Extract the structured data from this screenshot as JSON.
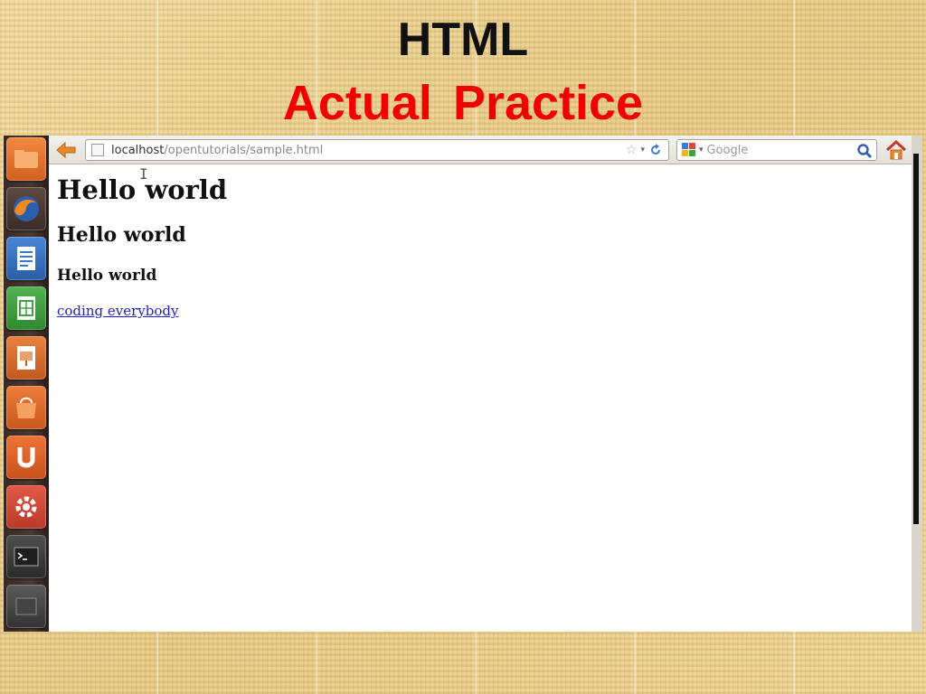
{
  "slide": {
    "title": "HTML",
    "subtitle": "Actual Practice"
  },
  "launcher": {
    "items": [
      {
        "name": "files-icon",
        "color": "#e7762e"
      },
      {
        "name": "firefox-icon",
        "color": "#2a5fae"
      },
      {
        "name": "writer-icon",
        "color": "#3a78c9"
      },
      {
        "name": "calc-icon",
        "color": "#3fa33f"
      },
      {
        "name": "impress-icon",
        "color": "#d86a2a"
      },
      {
        "name": "software-center-icon",
        "color": "#e06a2a"
      },
      {
        "name": "ubuntu-one-icon",
        "color": "#e0642a"
      },
      {
        "name": "system-settings-icon",
        "color": "#d84a3a"
      },
      {
        "name": "terminal-icon",
        "color": "#3a3a3a"
      },
      {
        "name": "workspace-icon",
        "color": "#4a4a4a"
      }
    ]
  },
  "browser": {
    "url_host": "localhost",
    "url_path": "/opentutorials/sample.html",
    "search_placeholder": "Google"
  },
  "page": {
    "h1": "Hello world",
    "h2": "Hello world",
    "h3": "Hello world",
    "link": "coding everybody"
  },
  "colors": {
    "title": "#111111",
    "subtitle": "#f00000",
    "link": "#2222cc"
  }
}
